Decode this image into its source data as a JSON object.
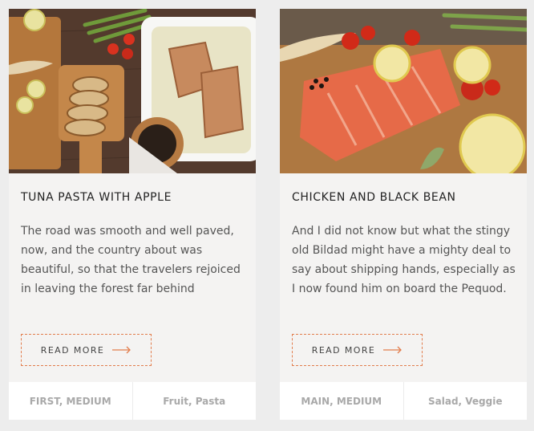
{
  "cards": [
    {
      "image_alt": "Fish fillets in a white baking dish with sliced bread, lemon and peppercorns",
      "title": "TUNA PASTA WITH APPLE",
      "description": "The road was smooth and well paved, now, and the country about was beautiful, so that the travelers rejoiced in leaving the forest far behind",
      "read_more": "READ MORE",
      "meta_left": "FIRST, MEDIUM",
      "meta_right": "Fruit, Pasta"
    },
    {
      "image_alt": "Raw salmon fillet on a cutting board with lemon slices and cherry tomatoes",
      "title": "CHICKEN AND BLACK BEAN",
      "description": "And I did not know but what the stingy old Bildad might have a mighty deal to say about shipping hands, especially as I now found him on board the Pequod.",
      "read_more": "READ MORE",
      "meta_left": "MAIN, MEDIUM",
      "meta_right": "Salad, Veggie"
    }
  ],
  "colors": {
    "accent": "#e27d4d",
    "card_bg": "#f4f3f2",
    "page_bg": "#ededed",
    "meta_text": "#a9a9a9"
  }
}
